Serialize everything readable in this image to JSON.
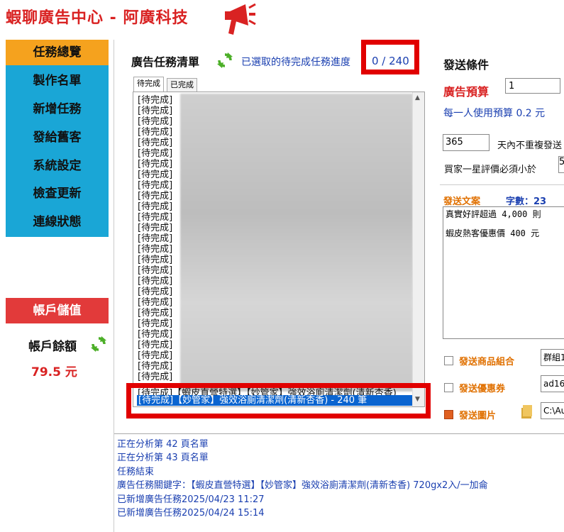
{
  "header": {
    "title": "蝦聊廣告中心 - 阿廣科技"
  },
  "sidebar": {
    "items": [
      {
        "label": "任務總覽",
        "active": true
      },
      {
        "label": "製作名單"
      },
      {
        "label": "新增任務"
      },
      {
        "label": "發給舊客"
      },
      {
        "label": "系統設定"
      },
      {
        "label": "檢查更新"
      },
      {
        "label": "連線狀態"
      }
    ],
    "topup_label": "帳戶儲值",
    "balance_label": "帳戶餘額",
    "balance_value": "79.5 元"
  },
  "tasklist": {
    "title": "廣告任務清單",
    "progress_label": "已選取的待完成任務進度",
    "progress_value": "0 / 240",
    "tabs": [
      "待完成",
      "已完成"
    ],
    "item_label": "[待完成]",
    "partial_row": "[待完成]【蝦皮直營特選】【妙管家】強效浴廁清潔劑(清新杏香)",
    "selected_row": "[待完成]【妙管家】強效浴廁清潔劑(清新杏香) - 240 筆"
  },
  "conditions": {
    "title": "發送條件",
    "budget_label": "廣告預算",
    "budget_value": "1",
    "per_user": "每一人使用預算 0.2 元",
    "days_value": "365",
    "days_label": "天內不重複發送",
    "rating_label": "買家一星評價必須小於",
    "rating_value": "5",
    "message_label": "發送文案",
    "count_label": "字數：23",
    "message_line1": "真實好評超過 4,000 則",
    "message_line2": "蝦皮熱客優惠價 400 元",
    "options": [
      {
        "label": "發送商品組合",
        "checked": false,
        "value": "群組1"
      },
      {
        "label": "發送優惠券",
        "checked": false,
        "value": "ad16"
      },
      {
        "label": "發送圖片",
        "checked": true,
        "value": "C:\\Au"
      }
    ]
  },
  "log": [
    "正在分析第 42 頁名單",
    "正在分析第 43 頁名單",
    "任務結束",
    "廣告任務關鍵字：【蝦皮直營特選】【妙管家】強效浴廁清潔劑(清新杏香) 720gx2入/一加侖",
    "已新增廣告任務2025/04/23 11:27",
    "已新增廣告任務2025/04/24 15:14"
  ],
  "colors": {
    "brand_red": "#d92222",
    "sidebar_blue": "#1aa6d6",
    "active_orange": "#f5a21e",
    "link_blue": "#1a3fb0",
    "highlight_red": "#e10000"
  },
  "icons": [
    "megaphone-icon",
    "refresh-icon",
    "folder-icon"
  ]
}
